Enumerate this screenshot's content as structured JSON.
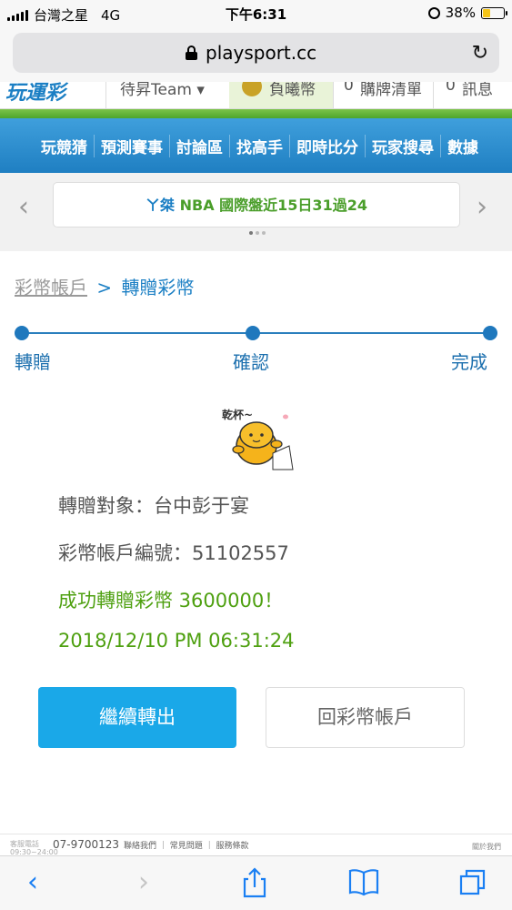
{
  "status_bar": {
    "carrier": "台灣之星",
    "network": "4G",
    "time": "下午6:31",
    "battery": "38%",
    "battery_level": 0.38
  },
  "browser": {
    "url": "playsport.cc"
  },
  "site_header": {
    "item_team": "待昇Team ▾",
    "item_coin": "負曦幣",
    "item_cart_count": "0",
    "item_cart": "購牌清單",
    "item_msg_count": "0",
    "item_msg": "訊息"
  },
  "nav": {
    "items": [
      "玩競猜",
      "預測賽事",
      "討論區",
      "找高手",
      "即時比分",
      "玩家搜尋",
      "數據"
    ]
  },
  "ticker": {
    "name": "ㄚ桀",
    "text": "NBA 國際盤近15日31過24"
  },
  "breadcrumb": {
    "parent": "彩幣帳戶",
    "separator": ">",
    "current": "轉贈彩幣"
  },
  "steps": {
    "labels": [
      "轉贈",
      "確認",
      "完成"
    ]
  },
  "sticker_text": "乾杯~",
  "result": {
    "recipient": "轉贈對象：台中彭于宴",
    "account": "彩幣帳戶編號：51102557",
    "success": "成功轉贈彩幣 3600000！",
    "timestamp": "2018/12/10 PM 06:31:24"
  },
  "buttons": {
    "continue": "繼續轉出",
    "back": "回彩幣帳戶"
  },
  "footer": {
    "hotline_label": "客服電話",
    "hotline_hours": "09:30~24:00",
    "phone": "07-9700123",
    "links": "聯絡我們 ｜ 常見問題 ｜ 服務條款",
    "right": "關於我們"
  },
  "colors": {
    "brand_blue": "#1b7fc4",
    "nav_blue": "#2a8fd2",
    "success_green": "#4ea010",
    "button_blue": "#1aa8e8"
  },
  "icons": [
    "signal-icon",
    "alarm-icon",
    "battery-icon",
    "lock-icon",
    "reload-icon",
    "back-icon",
    "forward-icon",
    "share-icon",
    "bookmarks-icon",
    "tabs-icon"
  ]
}
